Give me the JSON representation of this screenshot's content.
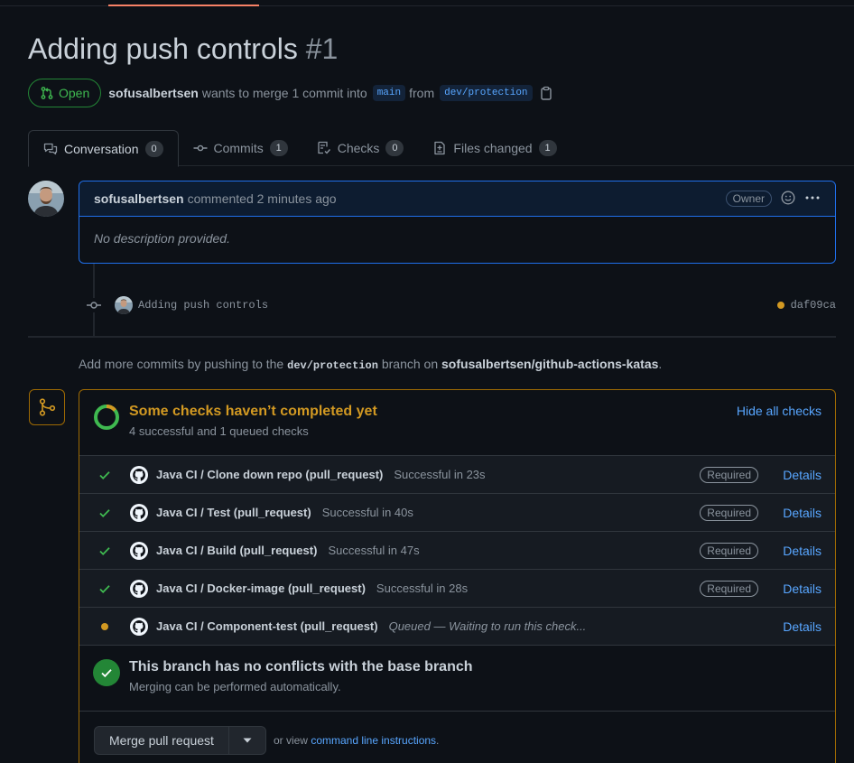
{
  "pr": {
    "title": "Adding push controls",
    "number": "#1",
    "state": "Open",
    "author": "sofusalbertsen",
    "summary": "wants to merge 1 commit into",
    "base_branch": "main",
    "from_word": "from",
    "head_branch": "dev/protection"
  },
  "tabs": [
    {
      "label": "Conversation",
      "count": "0",
      "icon": "comment-discussion-icon"
    },
    {
      "label": "Commits",
      "count": "1",
      "icon": "git-commit-icon"
    },
    {
      "label": "Checks",
      "count": "0",
      "icon": "checklist-icon"
    },
    {
      "label": "Files changed",
      "count": "1",
      "icon": "file-diff-icon"
    }
  ],
  "comment": {
    "author": "sofusalbertsen",
    "when": "commented 2 minutes ago",
    "role": "Owner",
    "body": "No description provided."
  },
  "commit": {
    "message": "Adding push controls",
    "sha": "daf09ca",
    "status_color": "#d29922"
  },
  "push_note": {
    "prefix": "Add more commits by pushing to the",
    "branch": "dev/protection",
    "middle": "branch on",
    "repo": "sofusalbertsen/github-actions-katas",
    "suffix": "."
  },
  "checks_summary": {
    "title": "Some checks haven’t completed yet",
    "subtitle": "4 successful and 1 queued checks",
    "hide_label": "Hide all checks"
  },
  "checks": [
    {
      "name": "Java CI / Clone down repo (pull_request)",
      "description": "Successful in 23s",
      "status": "success",
      "required": "Required",
      "details": "Details"
    },
    {
      "name": "Java CI / Test (pull_request)",
      "description": "Successful in 40s",
      "status": "success",
      "required": "Required",
      "details": "Details"
    },
    {
      "name": "Java CI / Build (pull_request)",
      "description": "Successful in 47s",
      "status": "success",
      "required": "Required",
      "details": "Details"
    },
    {
      "name": "Java CI / Docker-image (pull_request)",
      "description": "Successful in 28s",
      "status": "success",
      "required": "Required",
      "details": "Details"
    },
    {
      "name": "Java CI / Component-test (pull_request)",
      "description": "Queued — Waiting to run this check...",
      "status": "queued",
      "required": "",
      "details": "Details"
    }
  ],
  "conflicts": {
    "title": "This branch has no conflicts with the base branch",
    "subtitle": "Merging can be performed automatically."
  },
  "merge": {
    "button_label": "Merge pull request",
    "or_view": "or view",
    "link": "command line instructions",
    "suffix": "."
  },
  "colors": {
    "success": "#3fb950",
    "pending": "#d29922",
    "link": "#58a6ff"
  }
}
